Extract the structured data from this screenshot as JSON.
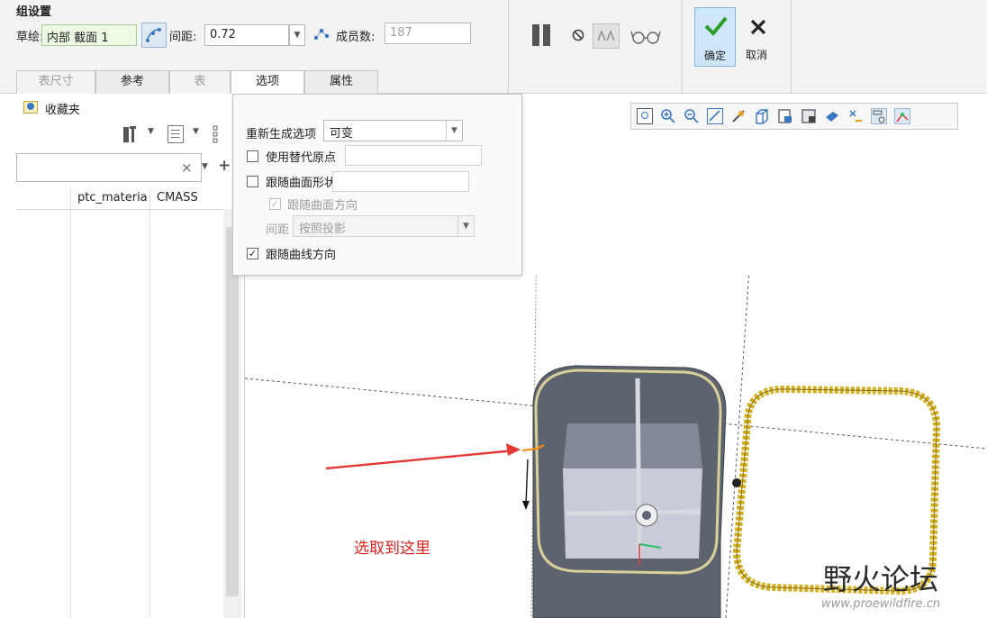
{
  "ribbon": {
    "title": "组设置",
    "sketch_label": "草绘:",
    "sketch_value": "内部 截面 1",
    "spacing_label": "间距:",
    "spacing_value": "0.72",
    "members_label": "成员数:",
    "members_value": "187",
    "ok_label": "确定",
    "cancel_label": "取消"
  },
  "tabs": [
    {
      "label": "表尺寸",
      "state": "dim"
    },
    {
      "label": "参考",
      "state": "normal"
    },
    {
      "label": "表",
      "state": "dim"
    },
    {
      "label": "选项",
      "state": "active"
    },
    {
      "label": "属性",
      "state": "normal"
    }
  ],
  "left_panel": {
    "favorites_label": "收藏夹",
    "clear_glyph": "×",
    "columns": [
      "ptc_materia",
      "CMASS"
    ]
  },
  "options_popup": {
    "regen_label": "重新生成选项",
    "regen_value": "可变",
    "use_alt_origin": {
      "label": "使用替代原点",
      "checked": false
    },
    "follow_surface_shape": {
      "label": "跟随曲面形状",
      "checked": false
    },
    "follow_surface_dir": {
      "label": "跟随曲面方向",
      "checked": true,
      "disabled": true
    },
    "spacing_label": "间距",
    "spacing_value": "按照投影",
    "follow_curve_dir": {
      "label": "跟随曲线方向",
      "checked": true
    }
  },
  "annotation": "选取到这里",
  "watermark": {
    "title": "野火论坛",
    "url": "www.proewildfire.cn"
  },
  "colors": {
    "accent_blue": "#cfe6fa",
    "check_green": "#2a9d2a",
    "arrow_red": "#e53935",
    "chain_gold": "#d4b01e"
  }
}
